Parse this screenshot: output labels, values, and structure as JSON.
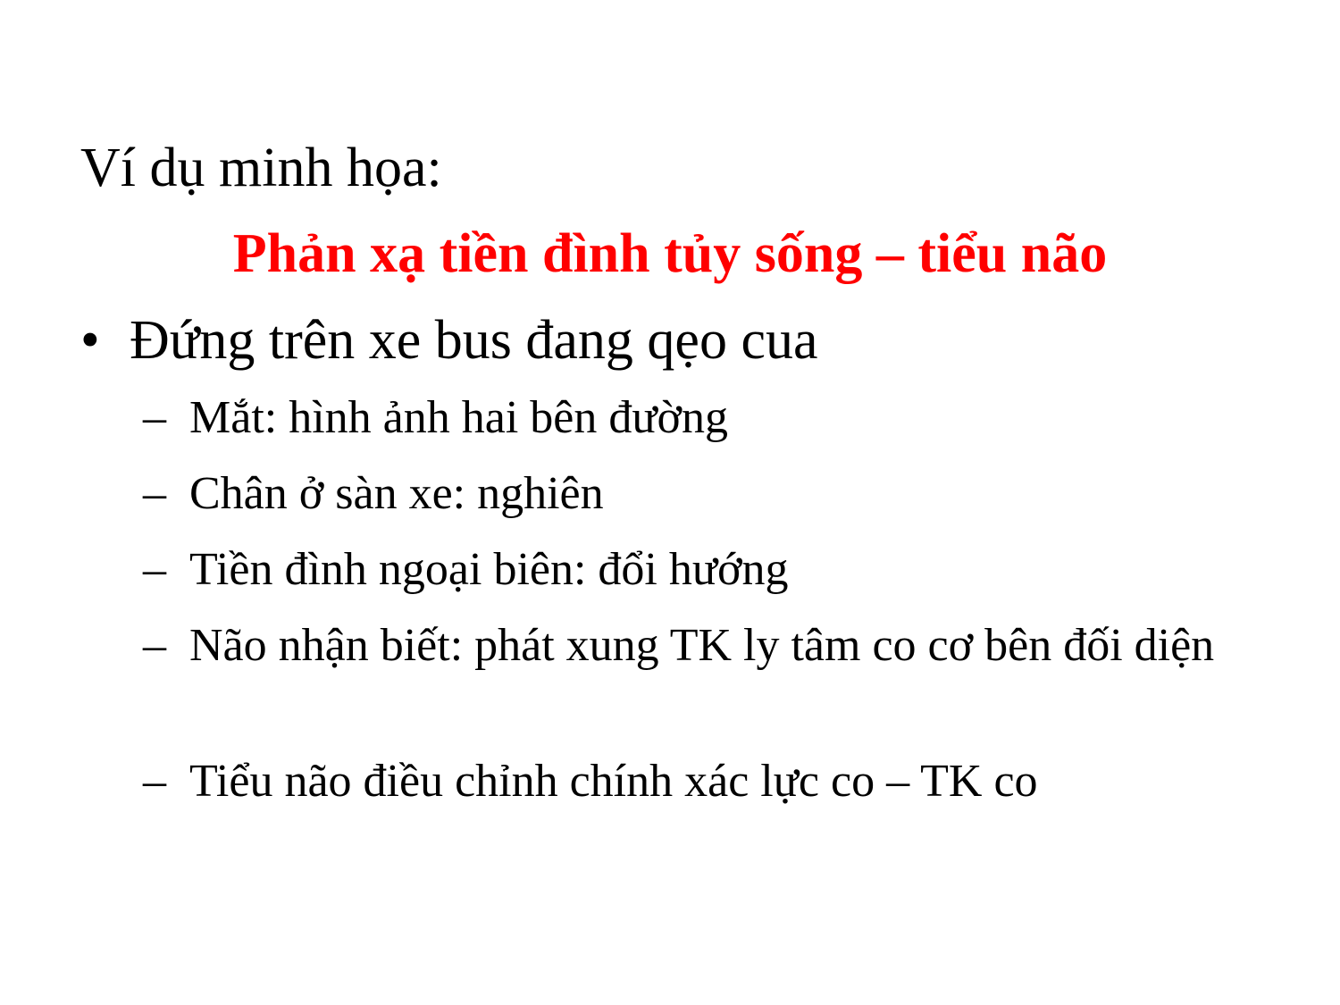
{
  "slide": {
    "intro": "Ví dụ minh họa:",
    "title": "Phản xạ tiền đình tủy sống – tiểu não",
    "bullet": {
      "marker": "•",
      "text": "Đứng trên xe bus đang qẹo cua"
    },
    "sub_marker": "–",
    "sub_items": [
      "Mắt: hình ảnh hai bên đường",
      "Chân ở sàn xe: nghiên",
      "Tiền đình ngoại biên: đổi hướng",
      "Não nhận biết: phát xung TK ly tâm co cơ bên đối diện",
      "Tiểu não điều chỉnh chính xác lực co – TK co"
    ],
    "colors": {
      "title": "#ff0000",
      "text": "#000000",
      "background": "#ffffff"
    }
  }
}
